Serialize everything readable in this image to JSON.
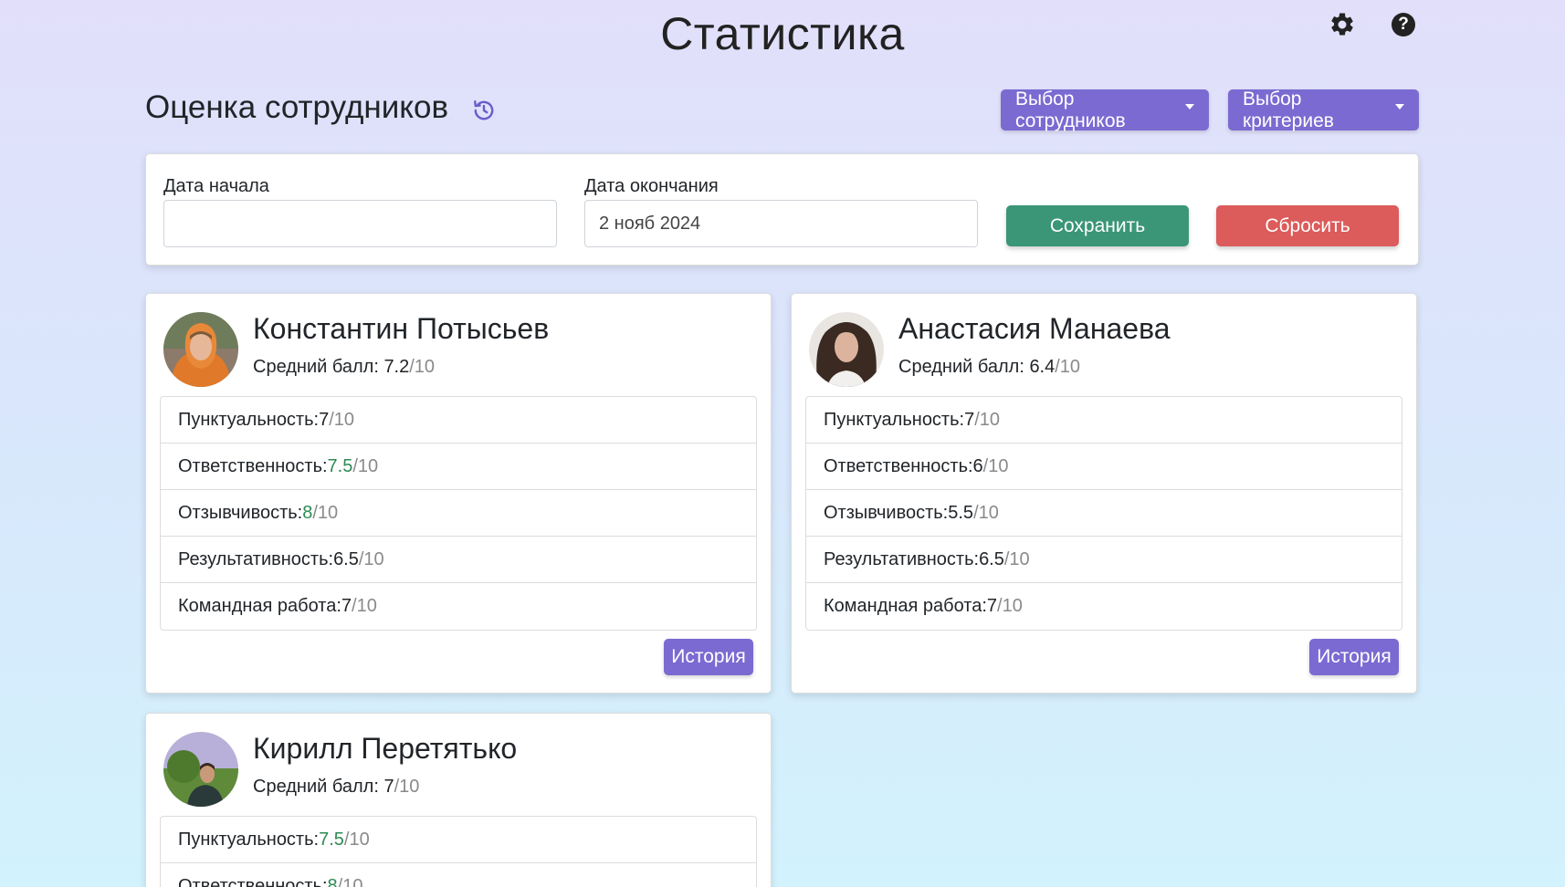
{
  "header": {
    "title": "Статистика",
    "settings_icon": "gear-icon",
    "help_icon": "question-circle-icon",
    "help_glyph": "?"
  },
  "section": {
    "title": "Оценка сотрудников",
    "history_icon": "history-icon",
    "employee_select_label": "Выбор сотрудников",
    "criteria_select_label": "Выбор критериев"
  },
  "filters": {
    "start_label": "Дата начала",
    "start_value": "",
    "end_label": "Дата окончания",
    "end_value": "2 нояб 2024",
    "save_label": "Сохранить",
    "reset_label": "Сбросить"
  },
  "colors": {
    "accent": "#7b6ad1",
    "save": "#3a9676",
    "reset": "#dc5b5b",
    "good_score": "#2e8a54"
  },
  "scale_suffix": "/10",
  "employees": [
    {
      "name": "Константин Потысьев",
      "avg_label": "Средний балл: ",
      "avg_value": "7.2",
      "history_label": "История",
      "criteria": [
        {
          "label": "Пунктуальность: ",
          "value": "7"
        },
        {
          "label": "Ответственность: ",
          "value": "7.5"
        },
        {
          "label": "Отзывчивость: ",
          "value": "8"
        },
        {
          "label": "Результативность: ",
          "value": "6.5"
        },
        {
          "label": "Командная работа: ",
          "value": "7"
        }
      ]
    },
    {
      "name": "Анастасия Манаева",
      "avg_label": "Средний балл: ",
      "avg_value": "6.4",
      "history_label": "История",
      "criteria": [
        {
          "label": "Пунктуальность: ",
          "value": "7"
        },
        {
          "label": "Ответственность: ",
          "value": "6"
        },
        {
          "label": "Отзывчивость: ",
          "value": "5.5"
        },
        {
          "label": "Результативность: ",
          "value": "6.5"
        },
        {
          "label": "Командная работа: ",
          "value": "7"
        }
      ]
    },
    {
      "name": "Кирилл Перетятько",
      "avg_label": "Средний балл: ",
      "avg_value": "7",
      "criteria": [
        {
          "label": "Пунктуальность: ",
          "value": "7.5"
        },
        {
          "label": "Ответственность: ",
          "value": "8"
        }
      ]
    }
  ]
}
